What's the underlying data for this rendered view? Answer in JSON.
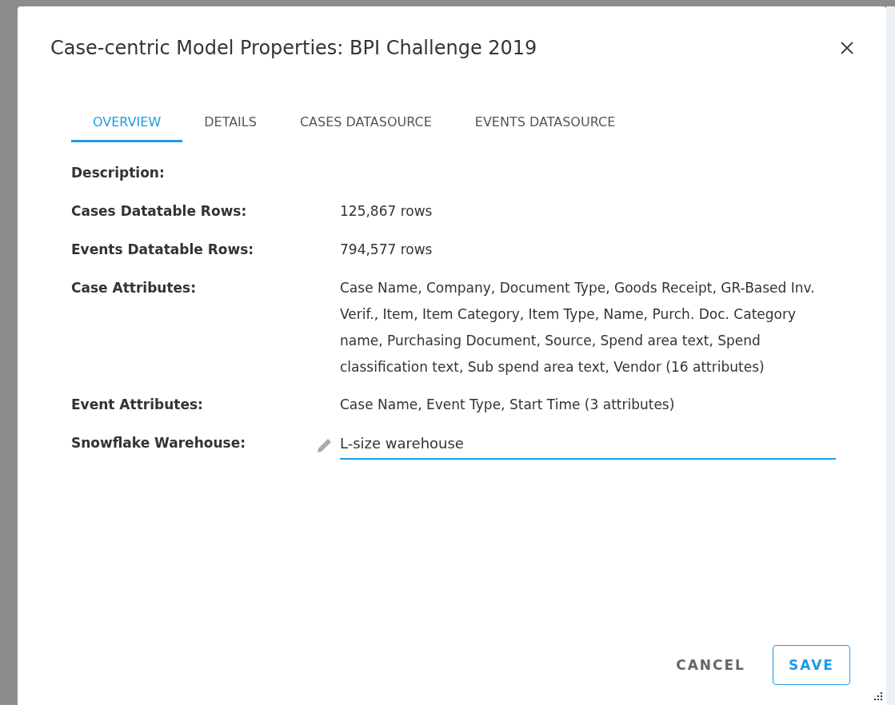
{
  "dialog": {
    "title": "Case-centric Model Properties: BPI Challenge 2019"
  },
  "tabs": [
    {
      "label": "OVERVIEW",
      "selected": true
    },
    {
      "label": "DETAILS",
      "selected": false
    },
    {
      "label": "CASES DATASOURCE",
      "selected": false
    },
    {
      "label": "EVENTS DATASOURCE",
      "selected": false
    }
  ],
  "properties": [
    {
      "kind": "text",
      "label": "Description:"
    },
    {
      "kind": "text",
      "label": "Cases Datatable Rows:",
      "value": "125,867 rows"
    },
    {
      "kind": "text",
      "label": "Events Datatable Rows:",
      "value": "794,577 rows"
    },
    {
      "kind": "text",
      "label": "Case Attributes:",
      "value": "Case Name, Company, Document Type, Goods Receipt, GR-Based Inv. Verif., Item, Item Category, Item Type, Name, Purch. Doc. Category name, Purchasing Document, Source, Spend area text, Spend classification text, Sub spend area text, Vendor (16 attributes)"
    },
    {
      "kind": "text",
      "label": "Event Attributes:",
      "value": "Case Name, Event Type, Start Time (3 attributes)"
    },
    {
      "kind": "field",
      "label": "Snowflake Warehouse:",
      "value": "L-size warehouse"
    }
  ],
  "buttons": [
    {
      "kind": "text",
      "label": "CANCEL"
    },
    {
      "kind": "outlined",
      "label": "SAVE"
    }
  ]
}
